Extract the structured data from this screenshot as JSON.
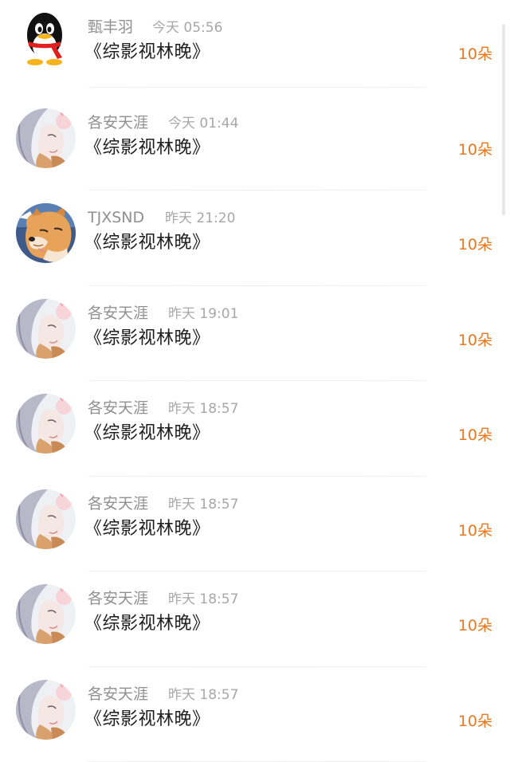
{
  "gifts": [
    {
      "username": "甄丰羽",
      "time": "今天 05:56",
      "title": "《综影视林晚》",
      "amount": "10朵",
      "avatar": "qq-penguin-icon"
    },
    {
      "username": "各安天涯",
      "time": "今天 01:44",
      "title": "《综影视林晚》",
      "amount": "10朵",
      "avatar": "anime-girl-avatar"
    },
    {
      "username": "TJXSND",
      "time": "昨天 21:20",
      "title": "《综影视林晚》",
      "amount": "10朵",
      "avatar": "shiba-dog-avatar"
    },
    {
      "username": "各安天涯",
      "time": "昨天 19:01",
      "title": "《综影视林晚》",
      "amount": "10朵",
      "avatar": "anime-girl-avatar"
    },
    {
      "username": "各安天涯",
      "time": "昨天 18:57",
      "title": "《综影视林晚》",
      "amount": "10朵",
      "avatar": "anime-girl-avatar"
    },
    {
      "username": "各安天涯",
      "time": "昨天 18:57",
      "title": "《综影视林晚》",
      "amount": "10朵",
      "avatar": "anime-girl-avatar"
    },
    {
      "username": "各安天涯",
      "time": "昨天 18:57",
      "title": "《综影视林晚》",
      "amount": "10朵",
      "avatar": "anime-girl-avatar"
    },
    {
      "username": "各安天涯",
      "time": "昨天 18:57",
      "title": "《综影视林晚》",
      "amount": "10朵",
      "avatar": "anime-girl-avatar"
    }
  ],
  "colors": {
    "amount": "#e8781f",
    "username": "#909090",
    "time": "#a7a7a7",
    "title": "#1e1e1e"
  }
}
